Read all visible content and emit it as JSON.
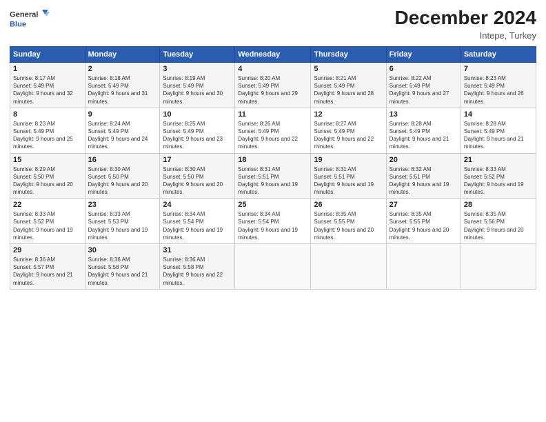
{
  "header": {
    "logo_line1": "General",
    "logo_line2": "Blue",
    "month": "December 2024",
    "location": "Intepe, Turkey"
  },
  "weekdays": [
    "Sunday",
    "Monday",
    "Tuesday",
    "Wednesday",
    "Thursday",
    "Friday",
    "Saturday"
  ],
  "weeks": [
    [
      {
        "day": "1",
        "sunrise": "8:17 AM",
        "sunset": "5:49 PM",
        "daylight": "9 hours and 32 minutes."
      },
      {
        "day": "2",
        "sunrise": "8:18 AM",
        "sunset": "5:49 PM",
        "daylight": "9 hours and 31 minutes."
      },
      {
        "day": "3",
        "sunrise": "8:19 AM",
        "sunset": "5:49 PM",
        "daylight": "9 hours and 30 minutes."
      },
      {
        "day": "4",
        "sunrise": "8:20 AM",
        "sunset": "5:49 PM",
        "daylight": "9 hours and 29 minutes."
      },
      {
        "day": "5",
        "sunrise": "8:21 AM",
        "sunset": "5:49 PM",
        "daylight": "9 hours and 28 minutes."
      },
      {
        "day": "6",
        "sunrise": "8:22 AM",
        "sunset": "5:49 PM",
        "daylight": "9 hours and 27 minutes."
      },
      {
        "day": "7",
        "sunrise": "8:23 AM",
        "sunset": "5:49 PM",
        "daylight": "9 hours and 26 minutes."
      }
    ],
    [
      {
        "day": "8",
        "sunrise": "8:23 AM",
        "sunset": "5:49 PM",
        "daylight": "9 hours and 25 minutes."
      },
      {
        "day": "9",
        "sunrise": "8:24 AM",
        "sunset": "5:49 PM",
        "daylight": "9 hours and 24 minutes."
      },
      {
        "day": "10",
        "sunrise": "8:25 AM",
        "sunset": "5:49 PM",
        "daylight": "9 hours and 23 minutes."
      },
      {
        "day": "11",
        "sunrise": "8:26 AM",
        "sunset": "5:49 PM",
        "daylight": "9 hours and 22 minutes."
      },
      {
        "day": "12",
        "sunrise": "8:27 AM",
        "sunset": "5:49 PM",
        "daylight": "9 hours and 22 minutes."
      },
      {
        "day": "13",
        "sunrise": "8:28 AM",
        "sunset": "5:49 PM",
        "daylight": "9 hours and 21 minutes."
      },
      {
        "day": "14",
        "sunrise": "8:28 AM",
        "sunset": "5:49 PM",
        "daylight": "9 hours and 21 minutes."
      }
    ],
    [
      {
        "day": "15",
        "sunrise": "8:29 AM",
        "sunset": "5:50 PM",
        "daylight": "9 hours and 20 minutes."
      },
      {
        "day": "16",
        "sunrise": "8:30 AM",
        "sunset": "5:50 PM",
        "daylight": "9 hours and 20 minutes."
      },
      {
        "day": "17",
        "sunrise": "8:30 AM",
        "sunset": "5:50 PM",
        "daylight": "9 hours and 20 minutes."
      },
      {
        "day": "18",
        "sunrise": "8:31 AM",
        "sunset": "5:51 PM",
        "daylight": "9 hours and 19 minutes."
      },
      {
        "day": "19",
        "sunrise": "8:31 AM",
        "sunset": "5:51 PM",
        "daylight": "9 hours and 19 minutes."
      },
      {
        "day": "20",
        "sunrise": "8:32 AM",
        "sunset": "5:51 PM",
        "daylight": "9 hours and 19 minutes."
      },
      {
        "day": "21",
        "sunrise": "8:33 AM",
        "sunset": "5:52 PM",
        "daylight": "9 hours and 19 minutes."
      }
    ],
    [
      {
        "day": "22",
        "sunrise": "8:33 AM",
        "sunset": "5:52 PM",
        "daylight": "9 hours and 19 minutes."
      },
      {
        "day": "23",
        "sunrise": "8:33 AM",
        "sunset": "5:53 PM",
        "daylight": "9 hours and 19 minutes."
      },
      {
        "day": "24",
        "sunrise": "8:34 AM",
        "sunset": "5:54 PM",
        "daylight": "9 hours and 19 minutes."
      },
      {
        "day": "25",
        "sunrise": "8:34 AM",
        "sunset": "5:54 PM",
        "daylight": "9 hours and 19 minutes."
      },
      {
        "day": "26",
        "sunrise": "8:35 AM",
        "sunset": "5:55 PM",
        "daylight": "9 hours and 20 minutes."
      },
      {
        "day": "27",
        "sunrise": "8:35 AM",
        "sunset": "5:55 PM",
        "daylight": "9 hours and 20 minutes."
      },
      {
        "day": "28",
        "sunrise": "8:35 AM",
        "sunset": "5:56 PM",
        "daylight": "9 hours and 20 minutes."
      }
    ],
    [
      {
        "day": "29",
        "sunrise": "8:36 AM",
        "sunset": "5:57 PM",
        "daylight": "9 hours and 21 minutes."
      },
      {
        "day": "30",
        "sunrise": "8:36 AM",
        "sunset": "5:58 PM",
        "daylight": "9 hours and 21 minutes."
      },
      {
        "day": "31",
        "sunrise": "8:36 AM",
        "sunset": "5:58 PM",
        "daylight": "9 hours and 22 minutes."
      },
      null,
      null,
      null,
      null
    ]
  ],
  "labels": {
    "sunrise": "Sunrise:",
    "sunset": "Sunset:",
    "daylight": "Daylight:"
  }
}
